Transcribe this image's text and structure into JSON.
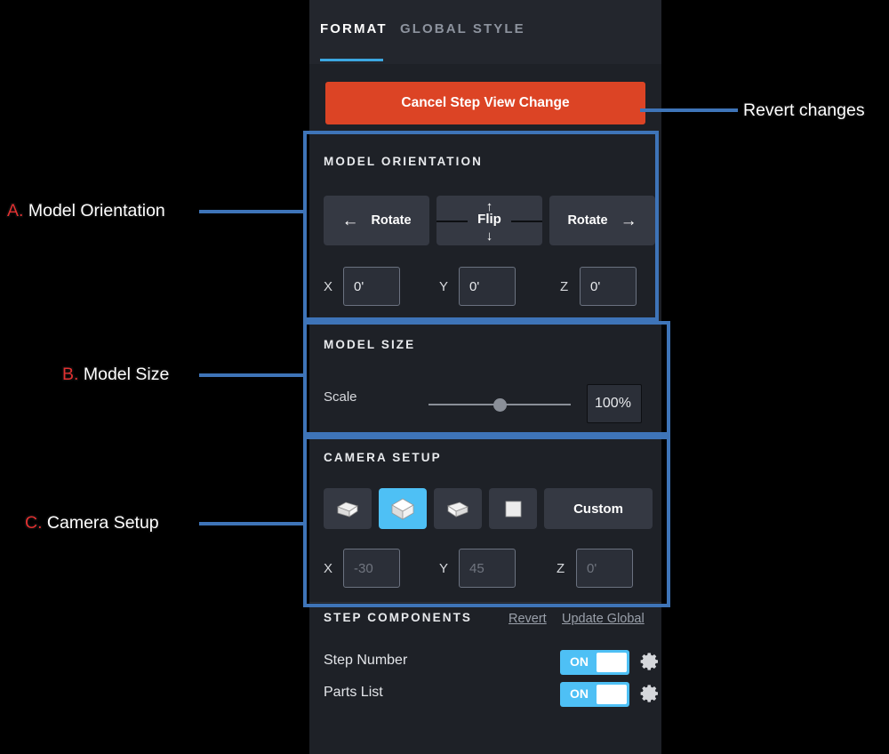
{
  "tabs": [
    {
      "label": "FORMAT",
      "active": true
    },
    {
      "label": "GLOBAL STYLE",
      "active": false
    }
  ],
  "cancel_button": {
    "label": "Cancel Step View Change",
    "color": "#dc4425"
  },
  "model_orientation": {
    "title": "MODEL ORIENTATION",
    "rotate_left": {
      "label": "Rotate",
      "icon": "arrow-left-icon",
      "glyph": "←"
    },
    "flip": {
      "label": "Flip",
      "up_glyph": "↑",
      "down_glyph": "↓"
    },
    "rotate_right": {
      "label": "Rotate",
      "icon": "arrow-right-icon",
      "glyph": "→"
    },
    "axes": [
      {
        "label": "X",
        "value": "0'"
      },
      {
        "label": "Y",
        "value": "0'"
      },
      {
        "label": "Z",
        "value": "0'"
      }
    ]
  },
  "model_size": {
    "title": "MODEL SIZE",
    "scale_label": "Scale",
    "scale_value": "100%",
    "slider_percent": 46
  },
  "camera_setup": {
    "title": "CAMERA SETUP",
    "views": [
      {
        "name": "iso-left-view",
        "selected": false
      },
      {
        "name": "iso-center-view",
        "selected": true
      },
      {
        "name": "iso-right-view",
        "selected": false
      },
      {
        "name": "front-view",
        "selected": false
      }
    ],
    "custom_label": "Custom",
    "accent": "#4ec0f5",
    "axes": [
      {
        "label": "X",
        "value": "-30"
      },
      {
        "label": "Y",
        "value": "45"
      },
      {
        "label": "Z",
        "value": "0'"
      }
    ]
  },
  "step_components": {
    "title": "STEP COMPONENTS",
    "revert_link": "Revert",
    "update_global_link": "Update Global",
    "items": [
      {
        "label": "Step Number",
        "toggle": "ON"
      },
      {
        "label": "Parts List",
        "toggle": "ON"
      }
    ]
  },
  "annotations": [
    {
      "prefix": "A.",
      "text": " Model Orientation"
    },
    {
      "prefix": "B.",
      "text": " Model Size"
    },
    {
      "prefix": "C.",
      "text": " Camera Setup"
    },
    {
      "prefix": "",
      "text": "Revert changes"
    }
  ]
}
